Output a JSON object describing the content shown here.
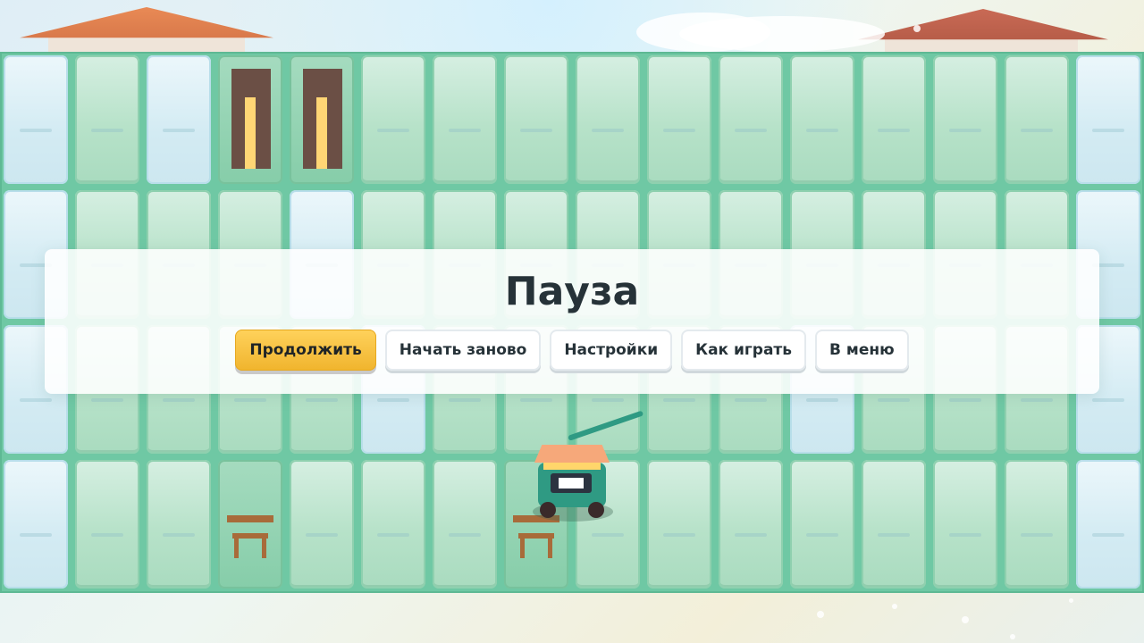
{
  "pause_menu": {
    "title": "Пауза",
    "buttons": {
      "continue": "Продолжить",
      "restart": "Начать заново",
      "settings": "Настройки",
      "how_to_play": "Как играть",
      "menu": "В меню"
    }
  },
  "colors": {
    "board": "#6fc8a4",
    "grass_tile": "#b7e2c9",
    "ice_tile": "#d3ebf3",
    "primary_button": "#f0b42d",
    "title_text": "#263238"
  },
  "scene": {
    "board_rows": 4,
    "board_cols": 16,
    "objects": [
      "door",
      "door",
      "bench",
      "bench",
      "cart"
    ]
  }
}
